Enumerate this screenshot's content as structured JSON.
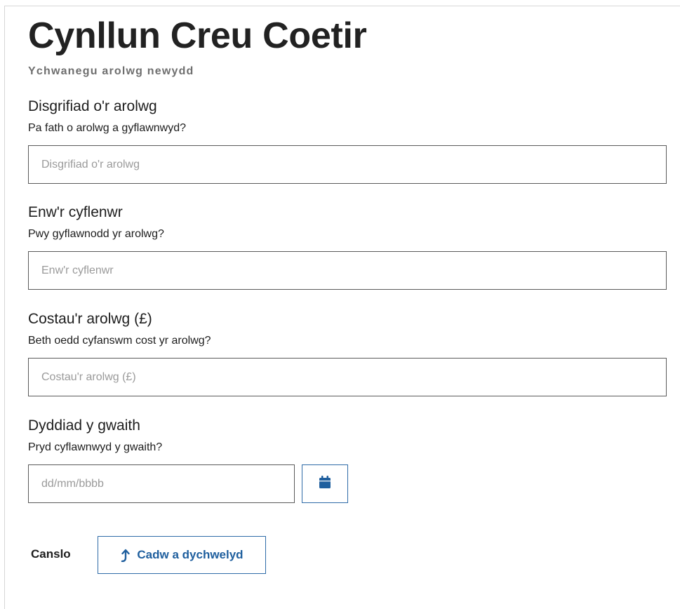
{
  "header": {
    "title": "Cynllun Creu Coetir",
    "subtitle": "Ychwanegu arolwg newydd"
  },
  "form": {
    "description": {
      "label": "Disgrifiad o'r arolwg",
      "hint": "Pa fath o arolwg a gyflawnwyd?",
      "placeholder": "Disgrifiad o'r arolwg",
      "value": ""
    },
    "contractor": {
      "label": "Enw'r cyflenwr",
      "hint": "Pwy gyflawnodd yr arolwg?",
      "placeholder": "Enw'r cyflenwr",
      "value": ""
    },
    "cost": {
      "label": "Costau'r arolwg (£)",
      "hint": "Beth oedd cyfanswm cost yr arolwg?",
      "placeholder": "Costau'r arolwg (£)",
      "value": ""
    },
    "date": {
      "label": "Dyddiad y gwaith",
      "hint": "Pryd cyflawnwyd y gwaith?",
      "placeholder": "dd/mm/bbbb",
      "value": "",
      "calendar_icon": "calendar-icon"
    }
  },
  "actions": {
    "cancel_label": "Canslo",
    "save_label": "Cadw a dychwelyd",
    "save_icon": "arrow-up-return-icon"
  },
  "colors": {
    "accent": "#2e6ba8",
    "accent_text": "#1f5f9e",
    "title": "#222222",
    "subtitle": "#6f6f6f",
    "border": "#5a5a5a",
    "placeholder": "#9a9a9a"
  }
}
